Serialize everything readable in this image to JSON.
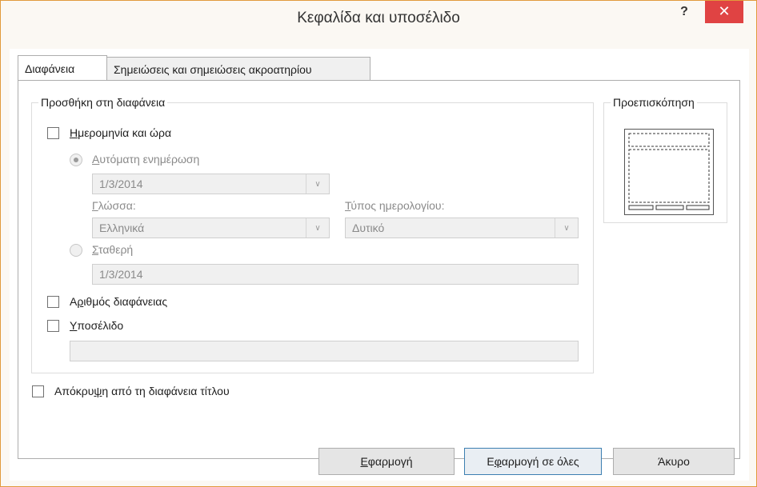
{
  "window": {
    "title": "Κεφαλίδα και υποσέλιδο",
    "help": "?",
    "close": "✕"
  },
  "tabs": [
    {
      "label": "Διαφάνεια",
      "active": true
    },
    {
      "label": "Σημειώσεις και σημειώσεις ακροατηρίου",
      "active": false
    }
  ],
  "include_group": {
    "legend": "Προσθήκη στη διαφάνεια",
    "date_time": {
      "label_u": "Η",
      "label_rest": "μερομηνία και ώρα",
      "checked": false
    },
    "auto_update": {
      "label_u": "Α",
      "label_rest": "υτόματη ενημέρωση",
      "selected": true
    },
    "auto_date_value": "1/3/2014",
    "language_label_u": "Γ",
    "language_label_rest": "λώσσα:",
    "language_value": "Ελληνικά",
    "calendar_label_u": "Τ",
    "calendar_label_rest": "ύπος ημερολογίου:",
    "calendar_value": "Δυτικό",
    "fixed": {
      "label_u": "Σ",
      "label_rest": "ταθερή",
      "selected": false
    },
    "fixed_value": "1/3/2014",
    "slide_number": {
      "label_pre": "Α",
      "label_u": "ρ",
      "label_rest": "ιθμός διαφάνειας",
      "checked": false
    },
    "footer": {
      "label_u": "Υ",
      "label_rest": "ποσέλιδο",
      "checked": false
    },
    "footer_value": ""
  },
  "preview": {
    "legend": "Προεπισκόπηση"
  },
  "hide_on_title": {
    "label_pre": "Απόκρυ",
    "label_u": "ψ",
    "label_rest": "η από τη διαφάνεια τίτλου",
    "checked": false
  },
  "buttons": {
    "apply_u": "Ε",
    "apply_rest": "φαρμογή",
    "apply_all_pre": "Ε",
    "apply_all_u": "φ",
    "apply_all_rest": "αρμογή σε όλες",
    "cancel": "Άκυρο"
  },
  "colors": {
    "close_bg": "#e04343",
    "window_border": "#e19a3c"
  }
}
